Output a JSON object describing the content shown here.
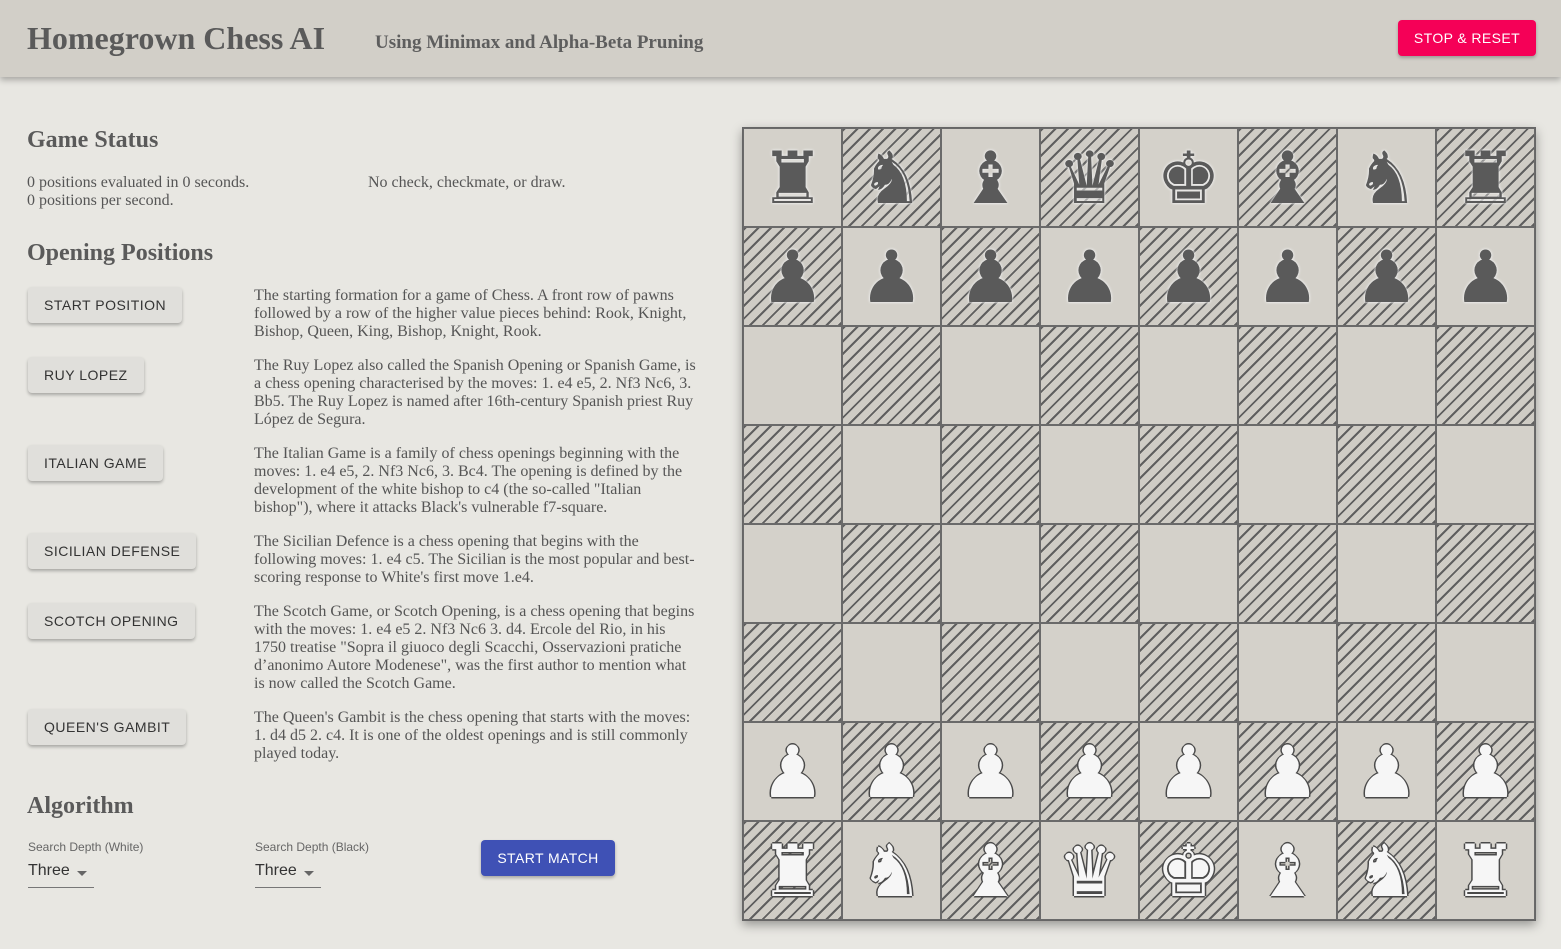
{
  "header": {
    "title": "Homegrown Chess AI",
    "subtitle": "Using Minimax and Alpha-Beta Pruning",
    "reset_label": "STOP & RESET",
    "reset_color": "#f50057"
  },
  "status": {
    "heading": "Game Status",
    "evaluated": "0 positions evaluated in 0 seconds.",
    "per_second": "0 positions per second.",
    "result": "No check, checkmate, or draw."
  },
  "openings": {
    "heading": "Opening Positions",
    "items": [
      {
        "label": "START POSITION",
        "description": "The starting formation for a game of Chess. A front row of pawns followed by a row of the higher value pieces behind: Rook, Knight, Bishop, Queen, King, Bishop, Knight, Rook."
      },
      {
        "label": "RUY LOPEZ",
        "description": "The Ruy Lopez also called the Spanish Opening or Spanish Game, is a chess opening characterised by the moves: 1. e4 e5, 2. Nf3 Nc6, 3. Bb5. The Ruy Lopez is named after 16th-century Spanish priest Ruy López de Segura."
      },
      {
        "label": "ITALIAN GAME",
        "description": "The Italian Game is a family of chess openings beginning with the moves: 1. e4 e5, 2. Nf3 Nc6, 3. Bc4. The opening is defined by the development of the white bishop to c4 (the so-called \"Italian bishop\"), where it attacks Black's vulnerable f7-square."
      },
      {
        "label": "SICILIAN DEFENSE",
        "description": "The Sicilian Defence is a chess opening that begins with the following moves: 1. e4 c5. The Sicilian is the most popular and best-scoring response to White's first move 1.e4."
      },
      {
        "label": "SCOTCH OPENING",
        "description": "The Scotch Game, or Scotch Opening, is a chess opening that begins with the moves: 1. e4 e5 2. Nf3 Nc6 3. d4. Ercole del Rio, in his 1750 treatise \"Sopra il giuoco degli Scacchi, Osservazioni pratiche d’anonimo Autore Modenese\", was the first author to mention what is now called the Scotch Game."
      },
      {
        "label": "QUEEN'S GAMBIT",
        "description": "The Queen's Gambit is the chess opening that starts with the moves: 1. d4 d5 2. c4. It is one of the oldest openings and is still commonly played today."
      }
    ]
  },
  "algorithm": {
    "heading": "Algorithm",
    "white_label": "Search Depth (White)",
    "white_value": "Three",
    "black_label": "Search Depth (Black)",
    "black_value": "Three",
    "start_label": "START MATCH",
    "start_color": "#3f51b5"
  },
  "board": {
    "rows": [
      [
        "br",
        "bn",
        "bb",
        "bq",
        "bk",
        "bb",
        "bn",
        "br"
      ],
      [
        "bp",
        "bp",
        "bp",
        "bp",
        "bp",
        "bp",
        "bp",
        "bp"
      ],
      [
        "",
        "",
        "",
        "",
        "",
        "",
        "",
        ""
      ],
      [
        "",
        "",
        "",
        "",
        "",
        "",
        "",
        ""
      ],
      [
        "",
        "",
        "",
        "",
        "",
        "",
        "",
        ""
      ],
      [
        "",
        "",
        "",
        "",
        "",
        "",
        "",
        ""
      ],
      [
        "wp",
        "wp",
        "wp",
        "wp",
        "wp",
        "wp",
        "wp",
        "wp"
      ],
      [
        "wr",
        "wn",
        "wb",
        "wq",
        "wk",
        "wb",
        "wn",
        "wr"
      ]
    ]
  }
}
